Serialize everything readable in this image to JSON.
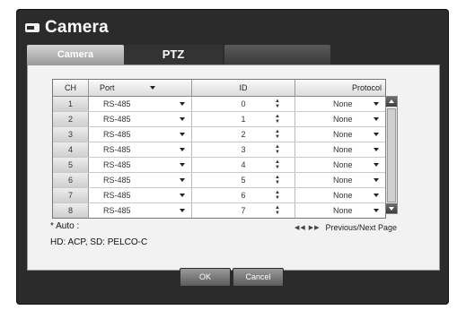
{
  "window": {
    "title": "Camera"
  },
  "tabs": [
    {
      "label": "Camera"
    },
    {
      "label": "PTZ"
    }
  ],
  "table": {
    "headers": {
      "ch": "CH",
      "port": "Port",
      "id": "ID",
      "protocol": "Protocol"
    },
    "rows": [
      {
        "ch": "1",
        "port": "RS-485",
        "id": "0",
        "protocol": "None"
      },
      {
        "ch": "2",
        "port": "RS-485",
        "id": "1",
        "protocol": "None"
      },
      {
        "ch": "3",
        "port": "RS-485",
        "id": "2",
        "protocol": "None"
      },
      {
        "ch": "4",
        "port": "RS-485",
        "id": "3",
        "protocol": "None"
      },
      {
        "ch": "5",
        "port": "RS-485",
        "id": "4",
        "protocol": "None"
      },
      {
        "ch": "6",
        "port": "RS-485",
        "id": "5",
        "protocol": "None"
      },
      {
        "ch": "7",
        "port": "RS-485",
        "id": "6",
        "protocol": "None"
      },
      {
        "ch": "8",
        "port": "RS-485",
        "id": "7",
        "protocol": "None"
      }
    ]
  },
  "notes": {
    "auto": "* Auto :",
    "auto_detail": "HD: ACP, SD: PELCO-C",
    "pager": "Previous/Next Page"
  },
  "buttons": {
    "ok": "OK",
    "cancel": "Cancel"
  },
  "icons": {
    "window": "camera-icon",
    "pager": "double-arrow-icon"
  }
}
